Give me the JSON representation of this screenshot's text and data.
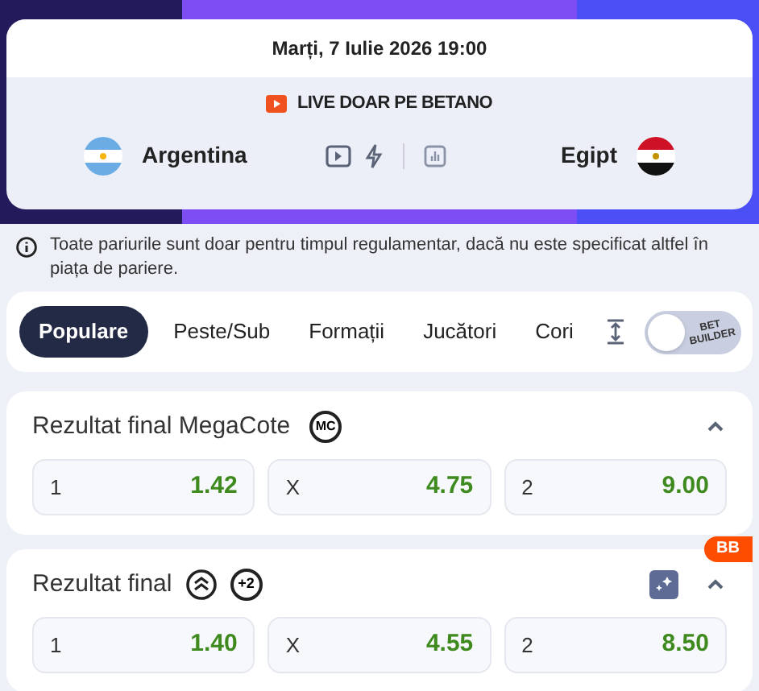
{
  "event": {
    "datetime": "Marți, 7 Iulie 2026 19:00",
    "live_label": "LIVE DOAR PE BETANO",
    "home": "Argentina",
    "away": "Egipt"
  },
  "notice": "Toate pariurile sunt doar pentru timpul regulamentar, dacă nu este specificat altfel în piața de pariere.",
  "tabs": [
    {
      "label": "Populare",
      "selected": true
    },
    {
      "label": "Peste/Sub",
      "selected": false
    },
    {
      "label": "Formații",
      "selected": false
    },
    {
      "label": "Jucători",
      "selected": false
    },
    {
      "label": "Cori",
      "selected": false
    }
  ],
  "bet_builder": {
    "label_1": "BET",
    "label_2": "BUILDER",
    "on": false
  },
  "markets": [
    {
      "title": "Rezultat final MegaCote",
      "badge": "MC",
      "builder_icon": false,
      "expanded": true,
      "odds": [
        {
          "label": "1",
          "value": "1.42"
        },
        {
          "label": "X",
          "value": "4.75"
        },
        {
          "label": "2",
          "value": "9.00"
        }
      ]
    },
    {
      "title": "Rezultat final",
      "extra_badge": "+2",
      "corner_badge": "BB",
      "builder_icon": true,
      "expanded": true,
      "odds": [
        {
          "label": "1",
          "value": "1.40"
        },
        {
          "label": "X",
          "value": "4.55"
        },
        {
          "label": "2",
          "value": "8.50"
        }
      ]
    }
  ]
}
